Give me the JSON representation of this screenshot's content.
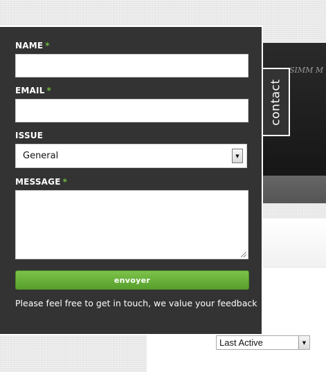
{
  "contact_form": {
    "tab_label": "contact",
    "required_mark": "*",
    "name": {
      "label": "NAME",
      "value": ""
    },
    "email": {
      "label": "EMAIL",
      "value": ""
    },
    "issue": {
      "label": "ISSUE",
      "selected": "General"
    },
    "message": {
      "label": "MESSAGE",
      "value": ""
    },
    "submit_label": "envoyer",
    "note": "Please feel free to get in touch, we value your feedback"
  },
  "background_page": {
    "header_text": "SIMM M",
    "sort_select": {
      "selected": "Last Active"
    }
  },
  "colors": {
    "panel": "#333333",
    "accent_green": "#6fb83e",
    "button_green": "#64ad36"
  },
  "icons": {
    "select_arrow": "triangle-down",
    "resize_grip": "diagonal-lines"
  }
}
